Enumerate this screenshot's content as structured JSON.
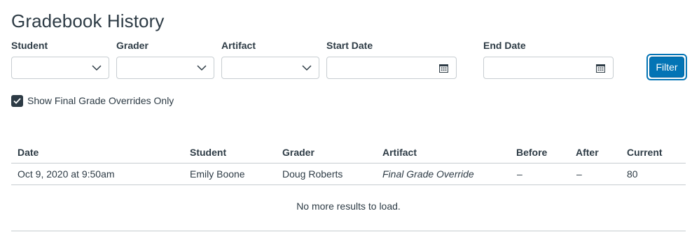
{
  "page": {
    "title": "Gradebook History"
  },
  "filters": {
    "student_label": "Student",
    "grader_label": "Grader",
    "artifact_label": "Artifact",
    "start_date_label": "Start Date",
    "end_date_label": "End Date",
    "student_value": "",
    "grader_value": "",
    "artifact_value": "",
    "start_date_value": "",
    "end_date_value": "",
    "filter_button": "Filter"
  },
  "override_checkbox": {
    "label": "Show Final Grade Overrides Only",
    "checked": true
  },
  "table": {
    "columns": [
      "Date",
      "Student",
      "Grader",
      "Artifact",
      "Before",
      "After",
      "Current"
    ],
    "rows": [
      [
        "Oct 9, 2020 at 9:50am",
        "Emily Boone",
        "Doug Roberts",
        "Final Grade Override",
        "–",
        "–",
        "80"
      ]
    ],
    "footer": "No more results to load."
  },
  "colors": {
    "accent": "#0374b5",
    "text": "#2d3b45",
    "border": "#c7cdd1"
  }
}
